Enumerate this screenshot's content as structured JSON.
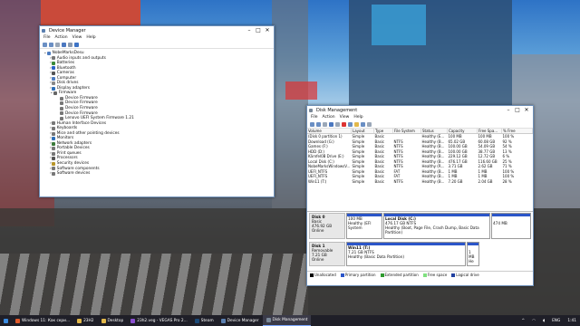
{
  "device_manager": {
    "title": "Device Manager",
    "menu": [
      "File",
      "Action",
      "View",
      "Help"
    ],
    "root": "NobeMarksDesu",
    "categories": [
      "Audio inputs and outputs",
      "Batteries",
      "Bluetooth",
      "Cameras",
      "Computer",
      "Disk drives",
      "Display adapters",
      "Firmware"
    ],
    "firmware_children": [
      "Device Firmware",
      "Device Firmware",
      "Device Firmware",
      "Device Firmware",
      "Lenovo UEFI System Firmware 1.21"
    ],
    "categories_after": [
      "Human Interface Devices",
      "Keyboards",
      "Mice and other pointing devices",
      "Monitors",
      "Network adapters",
      "Portable Devices",
      "Print queues",
      "Processors",
      "Security devices",
      "Software components",
      "Software devices"
    ]
  },
  "disk_management": {
    "title": "Disk Management",
    "menu": [
      "File",
      "Action",
      "View",
      "Help"
    ],
    "columns": [
      "Volume",
      "Layout",
      "Type",
      "File System",
      "Status",
      "Capacity",
      "Free Spa...",
      "% Free"
    ],
    "rows": [
      [
        "(Disk 0 partition 1)",
        "Simple",
        "Basic",
        "",
        "Healthy (E...",
        "100 MB",
        "100 MB",
        "100 %"
      ],
      [
        "Download (G:)",
        "Simple",
        "Basic",
        "NTFS",
        "Healthy (B...",
        "65.02 GB",
        "60.08 GB",
        "92 %"
      ],
      [
        "Games (F:)",
        "Simple",
        "Basic",
        "NTFS",
        "Healthy (B...",
        "100.00 GB",
        "54.09 GB",
        "54 %"
      ],
      [
        "HDD (D:)",
        "Simple",
        "Basic",
        "NTFS",
        "Healthy (B...",
        "100.00 GB",
        "38.77 GB",
        "13 %"
      ],
      [
        "Kärnfel0B Drive (E:)",
        "Simple",
        "Basic",
        "NTFS",
        "Healthy (B...",
        "229.12 GB",
        "12.72 GB",
        "6 %"
      ],
      [
        "Local Disk (C:)",
        "Simple",
        "Basic",
        "NTFS",
        "Healthy (B...",
        "476.17 GB",
        "116.60 GB",
        "25 %"
      ],
      [
        "NobeMarksWindowsV...",
        "Simple",
        "Basic",
        "NTFS",
        "Healthy (R...",
        "3.71 GB",
        "2.62 GB",
        "71 %"
      ],
      [
        "UEFI_NTFS",
        "Simple",
        "Basic",
        "FAT",
        "Healthy (B...",
        "1 MB",
        "1 MB",
        "100 %"
      ],
      [
        "UEFI_NTFS",
        "Simple",
        "Basic",
        "FAT",
        "Healthy (B...",
        "1 MB",
        "1 MB",
        "100 %"
      ],
      [
        "Win11 (T:)",
        "Simple",
        "Basic",
        "NTFS",
        "Healthy (B...",
        "7.20 GB",
        "2.04 GB",
        "28 %"
      ]
    ],
    "disk0": {
      "label": "Disk 0",
      "type": "Basic",
      "size": "476.92 GB",
      "status": "Online",
      "p1_size": "100 MB",
      "p1_status": "Healthy (EFI System",
      "p2_name": "Local Disk (C:)",
      "p2_size": "476.17 GB NTFS",
      "p2_status": "Healthy (Boot, Page File, Crash Dump, Basic Data Partition)",
      "p3_size": "474 MB"
    },
    "disk1": {
      "label": "Disk 1",
      "type": "Removable",
      "size": "7.21 GB",
      "status": "Online",
      "p1_name": "Win11 (T:)",
      "p1_size": "7.21 GB NTFS",
      "p1_status": "Healthy (Basic Data Partition)",
      "p2_size": "1 MB",
      "p2_status": "He"
    },
    "legend": [
      "Unallocated",
      "Primary partition",
      "Extended partition",
      "Free space",
      "Logical drive"
    ],
    "legend_colors": [
      "#000000",
      "#2b55c9",
      "#2f9b2f",
      "#7fe07f",
      "#2040a0"
    ]
  },
  "taskbar": {
    "items": [
      "Windows 11: Как скри...",
      "23H2",
      "Desktop",
      "23h2.veg - VEGAS Pro 2...",
      "Steam",
      "Device Manager",
      "Disk Management"
    ],
    "lang": "ENG",
    "time": "1:41"
  }
}
